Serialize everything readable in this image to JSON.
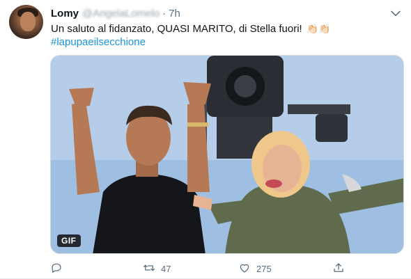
{
  "tweet": {
    "author_name": "Lomy",
    "author_handle": "@AngelaLomelo",
    "separator": "·",
    "time": "7h",
    "text": "Un saluto al fidanzato, QUASI MARITO, di Stella fuori!",
    "emoji": "👏🏻👏🏻",
    "hashtag": "#lapupaeilsecchione",
    "media_badge": "GIF"
  },
  "actions": {
    "reply_count": "",
    "retweet_count": "47",
    "like_count": "275"
  },
  "icons": {
    "menu": "chevron-down-icon",
    "reply": "reply-icon",
    "retweet": "retweet-icon",
    "like": "heart-icon",
    "share": "share-icon"
  },
  "colors": {
    "link": "#1b95e0",
    "muted": "#5b7083",
    "text": "#0f1419"
  }
}
